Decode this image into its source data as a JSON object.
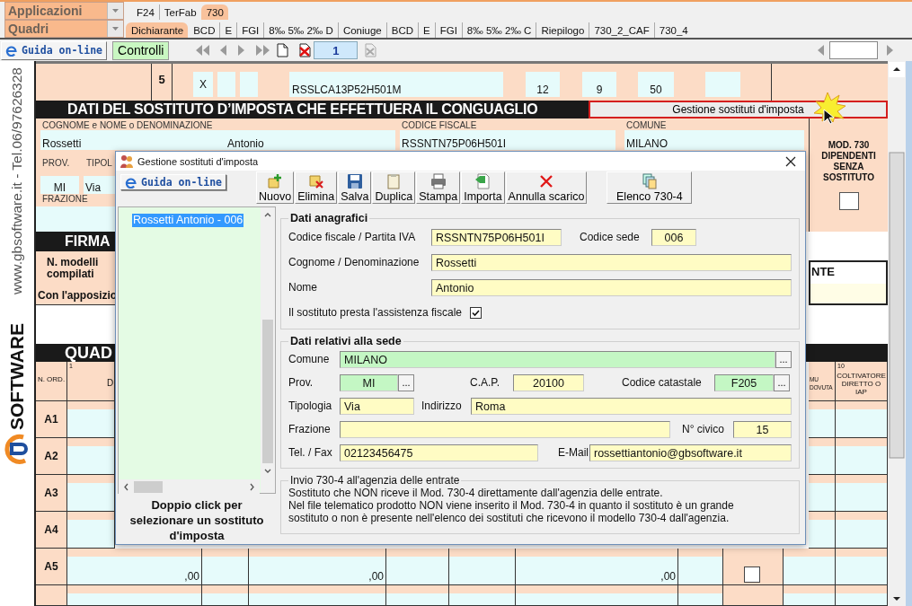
{
  "app_menus": [
    {
      "label": "Applicazioni"
    },
    {
      "label": "Quadri"
    }
  ],
  "module_tabs": [
    {
      "label": "F24",
      "selected": false
    },
    {
      "label": "TerFab",
      "selected": false
    },
    {
      "label": "730",
      "selected": true
    }
  ],
  "section_tabs": [
    {
      "label": "Dichiarante",
      "selected": true
    },
    {
      "label": "BCD",
      "selected": false
    },
    {
      "label": "E",
      "selected": false
    },
    {
      "label": "FGI",
      "selected": false
    },
    {
      "label": "8‰ 5‰ 2‰ D",
      "selected": false
    },
    {
      "label": "Coniuge",
      "selected": false
    },
    {
      "label": "BCD",
      "selected": false
    },
    {
      "label": "E",
      "selected": false
    },
    {
      "label": "FGI",
      "selected": false
    },
    {
      "label": "8‰ 5‰ 2‰ C",
      "selected": false
    },
    {
      "label": "Riepilogo",
      "selected": false
    },
    {
      "label": "730_2_CAF",
      "selected": false
    },
    {
      "label": "730_4",
      "selected": false
    }
  ],
  "toolbar": {
    "help_button": "Guida on-line",
    "controls_button": "Controlli",
    "page": "1"
  },
  "side_banner": {
    "contact": "www.gbsoftware.it - Tel.06/97626328",
    "brand": "SOFTWARE"
  },
  "form": {
    "top_row": {
      "number": "5",
      "mark": "X",
      "tax_code": "RSSLCA13P52H501M",
      "amounts": [
        "12",
        "9",
        "50"
      ]
    },
    "section_title": "DATI DEL SOSTITUTO D’IMPOSTA CHE EFFETTUERA IL CONGUAGLIO",
    "manage_button": "Gestione sostituti d'imposta",
    "name_label": "COGNOME e NOME o DENOMINAZIONE",
    "surname": "Rossetti",
    "first_name": "Antonio",
    "tax_code_label": "CODICE FISCALE",
    "tax_code": "RSSNTN75P06H501I",
    "city_label": "COMUNE",
    "city": "MILANO",
    "no_substitute": {
      "label": "MOD. 730 DIPENDENTI SENZA SOSTITUTO",
      "checked": false
    },
    "province_label": "PROV.",
    "type_label": "TIPOL",
    "province": "MI",
    "street_type": "Via",
    "hamlet_label": "FRAZIONE",
    "signature_title": "FIRMA",
    "models_label": "N. modelli compilati",
    "consent_text": "Con l'apposizio",
    "right_box_text": "NTE",
    "table_title": "QUAD",
    "columns": [
      {
        "label": "N. ORD."
      },
      {
        "number": "1",
        "label": "D"
      },
      {
        "label": "MU DOVUTA"
      },
      {
        "number": "10",
        "label": "COLTIVATORE DIRETTO O IAP"
      }
    ],
    "rows": [
      {
        "label": "A1"
      },
      {
        "label": "A2"
      },
      {
        "label": "A3"
      },
      {
        "label": "A4"
      },
      {
        "label": "A5",
        "amounts": [
          ",00",
          ",00",
          ",00"
        ],
        "checked": false
      }
    ]
  },
  "dialog": {
    "title": "Gestione sostituti d'imposta",
    "help_button": "Guida on-line",
    "actions": [
      {
        "kind": "new",
        "label": "Nuovo"
      },
      {
        "kind": "delete",
        "label": "Elimina"
      },
      {
        "kind": "save",
        "label": "Salva"
      },
      {
        "kind": "copy",
        "label": "Duplica"
      },
      {
        "kind": "print",
        "label": "Stampa"
      },
      {
        "kind": "import",
        "label": "Importa"
      },
      {
        "kind": "cancel",
        "label": "Annulla scarico"
      },
      {
        "kind": "list",
        "label": "Elenco 730-4"
      }
    ],
    "substitutes": [
      {
        "label": "Rossetti Antonio - 006",
        "selected": true
      }
    ],
    "list_hint": "Doppio click per selezionare un sostituto d'imposta",
    "groups": [
      {
        "kind": "form",
        "title": "Dati anagrafici",
        "rows": [
          [
            {
              "kind": "text",
              "label": "Codice fiscale / Partita IVA",
              "value": "RSSNTN75P06H501I"
            },
            {
              "kind": "text",
              "label": "Codice sede",
              "value": "006"
            }
          ],
          [
            {
              "kind": "text",
              "label": "Cognome / Denominazione",
              "value": "Rossetti"
            }
          ],
          [
            {
              "kind": "text",
              "label": "Nome",
              "value": "Antonio"
            }
          ],
          [
            {
              "kind": "checkbox",
              "label": "Il sostituto presta l'assistenza fiscale",
              "checked": true
            }
          ]
        ]
      },
      {
        "kind": "form",
        "title": "Dati relativi alla sede",
        "rows": [
          [
            {
              "kind": "lookup",
              "label": "Comune",
              "value": "MILANO",
              "button": "..."
            }
          ],
          [
            {
              "kind": "lookup",
              "label": "Prov.",
              "value": "MI",
              "button": "..."
            },
            {
              "kind": "text",
              "label": "C.A.P.",
              "value": "20100"
            },
            {
              "kind": "lookup",
              "label": "Codice catastale",
              "value": "F205",
              "button": "..."
            }
          ],
          [
            {
              "kind": "text",
              "label": "Tipologia",
              "value": "Via"
            },
            {
              "kind": "text",
              "label": "Indirizzo",
              "value": "Roma"
            }
          ],
          [
            {
              "kind": "text",
              "label": "Frazione"
            },
            {
              "kind": "text",
              "label": "N° civico",
              "value": "15"
            }
          ],
          [
            {
              "kind": "text",
              "label": "Tel. / Fax",
              "value": "02123456475"
            },
            {
              "kind": "text",
              "label": "E-Mail",
              "value": "rossettiantonio@gbsoftware.it"
            }
          ]
        ]
      },
      {
        "kind": "notice",
        "title": "Invio 730-4 all'agenzia delle entrate",
        "paragraphs": [
          "Sostituto che NON riceve il Mod. 730-4 direttamente dall'agenzia delle entrate.",
          "Nel file telematico prodotto NON viene inserito il Mod. 730-4 in quanto il sostituto è un grande sostituto o non è presente nell'elenco dei sostituti che ricevono il modello 730-4 dall'agenzia."
        ]
      }
    ]
  }
}
